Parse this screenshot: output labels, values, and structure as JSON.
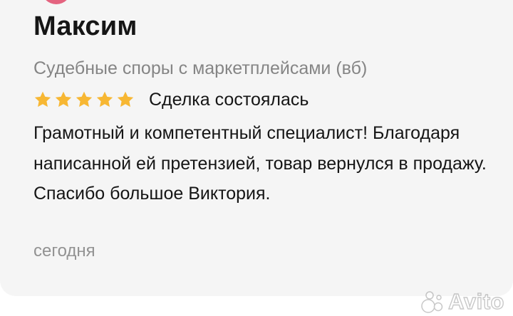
{
  "review": {
    "author_name": "Максим",
    "service": "Судебные споры с маркетплейсами (вб)",
    "rating": 5,
    "rating_max": 5,
    "deal_status": "Сделка состоялась",
    "text": "Грамотный и компетентный специалист! Благодаря написанной ей претензией, товар вернулся в продажу. Спасибо большое Виктория.",
    "date": "сегодня"
  },
  "watermark": {
    "brand": "Avito"
  },
  "colors": {
    "star": "#f7b733",
    "avatar": "#e4637f",
    "card_background": "#f5f5f5",
    "secondary_text": "#858585"
  }
}
